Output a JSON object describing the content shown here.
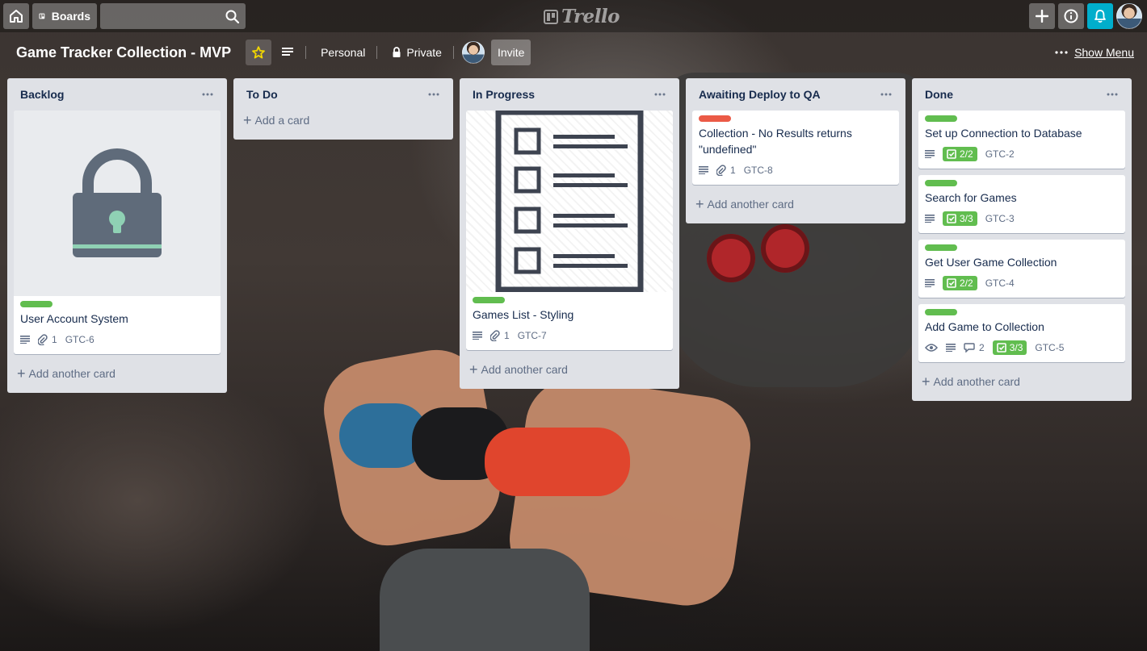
{
  "header": {
    "boards_label": "Boards",
    "search_placeholder": "",
    "logo_text": "Trello"
  },
  "board": {
    "title": "Game Tracker Collection - MVP",
    "team_label": "Personal",
    "visibility_label": "Private",
    "invite_label": "Invite",
    "show_menu_label": "Show Menu"
  },
  "lists": [
    {
      "title": "Backlog",
      "add_label": "Add another card",
      "cards": [
        {
          "title": "User Account System",
          "label_color": "#61bd4f",
          "attachments": "1",
          "key": "GTC-6",
          "cover": "lock-icon"
        }
      ]
    },
    {
      "title": "To Do",
      "add_label": "Add a card",
      "cards": []
    },
    {
      "title": "In Progress",
      "add_label": "Add another card",
      "cards": [
        {
          "title": "Games List - Styling",
          "label_color": "#61bd4f",
          "attachments": "1",
          "key": "GTC-7",
          "cover": "checklist-document-icon"
        }
      ]
    },
    {
      "title": "Awaiting Deploy to QA",
      "add_label": "Add another card",
      "cards": [
        {
          "title": "Collection - No Results returns \"undefined\"",
          "label_color": "#eb5a46",
          "attachments": "1",
          "key": "GTC-8"
        }
      ]
    },
    {
      "title": "Done",
      "add_label": "Add another card",
      "cards": [
        {
          "title": "Set up Connection to Database",
          "label_color": "#61bd4f",
          "checklist": "2/2",
          "key": "GTC-2"
        },
        {
          "title": "Search for Games",
          "label_color": "#61bd4f",
          "checklist": "3/3",
          "key": "GTC-3"
        },
        {
          "title": "Get User Game Collection",
          "label_color": "#61bd4f",
          "checklist": "2/2",
          "key": "GTC-4"
        },
        {
          "title": "Add Game to Collection",
          "label_color": "#61bd4f",
          "comments": "2",
          "checklist": "3/3",
          "key": "GTC-5"
        }
      ]
    }
  ],
  "colors": {
    "list_bg": "#dfe1e6",
    "label_green": "#61bd4f",
    "label_red": "#eb5a46",
    "notification_blue": "#00aecc",
    "star_yellow": "#f2d600"
  }
}
